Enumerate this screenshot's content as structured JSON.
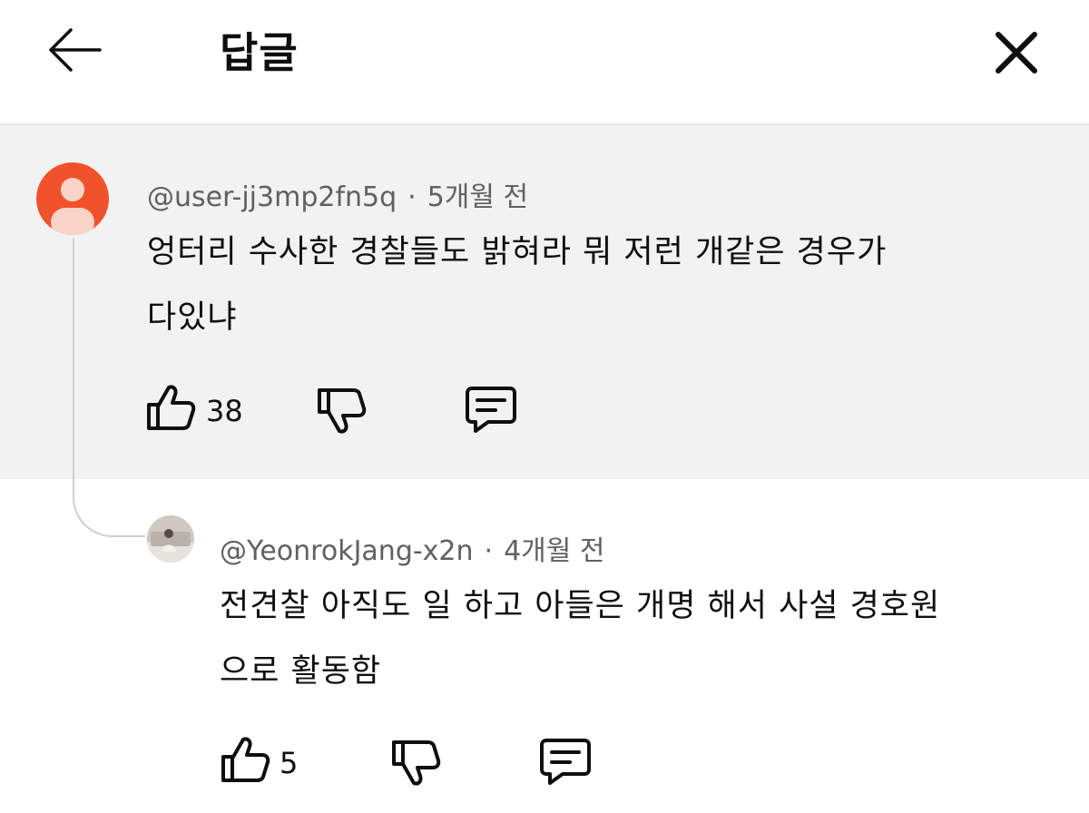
{
  "header": {
    "title": "답글",
    "back_icon": "arrow-left-icon",
    "close_icon": "close-icon"
  },
  "parent_comment": {
    "username": "@user-jj3mp2fn5q",
    "time": "5개월 전",
    "separator": "·",
    "text_line1": "엉터리 수사한 경찰들도 밝혀라 뭐 저런 개같은 경우가",
    "text_line2": "다있냐",
    "likes": "38",
    "avatar_color": "#f0532b"
  },
  "reply_comment": {
    "username": "@YeonrokJang-x2n",
    "time": "4개월 전",
    "separator": "·",
    "text_line1": "전견찰 아직도 일 하고 아들은 개명 해서 사설 경호원",
    "text_line2": "으로 활동함",
    "likes": "5"
  },
  "icons": {
    "like": "thumbs-up-icon",
    "dislike": "thumbs-down-icon",
    "reply": "comment-icon"
  }
}
